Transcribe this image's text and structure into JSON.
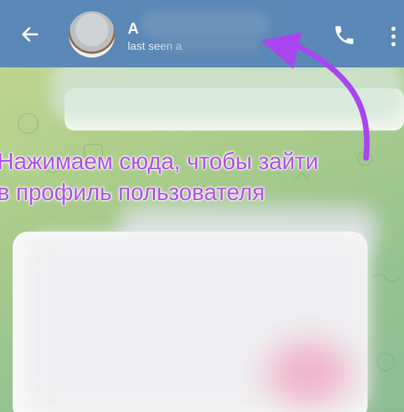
{
  "header": {
    "title": "А",
    "subtitle": "last seen a",
    "back_icon": "arrow-left-icon",
    "call_icon": "phone-icon",
    "more_icon": "more-vertical-icon",
    "bg_color": "#5b88b6"
  },
  "chat": {
    "background_color": "#a9cc8b"
  },
  "annotation": {
    "line1": "Нажимаем сюда, чтобы зайти",
    "line2": "в профиль пользователя",
    "color": "#b04dea"
  }
}
